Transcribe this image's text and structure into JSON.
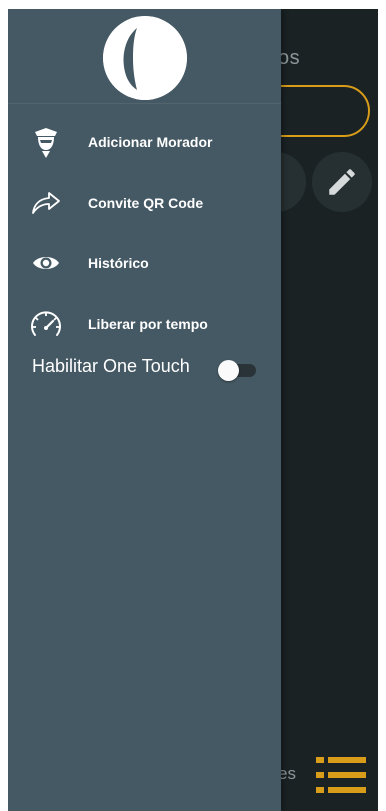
{
  "background_screen": {
    "title_fragment": "os",
    "bottom_label_fragment": "es"
  },
  "drawer": {
    "items": [
      {
        "label": "Adicionar Morador",
        "icon": "user-add-icon"
      },
      {
        "label": "Convite QR Code",
        "icon": "share-arrow-icon"
      },
      {
        "label": "Histórico",
        "icon": "eye-icon"
      },
      {
        "label": "Liberar por tempo",
        "icon": "speedometer-icon"
      }
    ],
    "one_touch": {
      "label": "Habilitar One Touch",
      "enabled": false
    }
  },
  "colors": {
    "drawer_bg": "#455964",
    "background_screen": "#1a2224",
    "accent": "#d99d19",
    "text": "#ffffff"
  }
}
